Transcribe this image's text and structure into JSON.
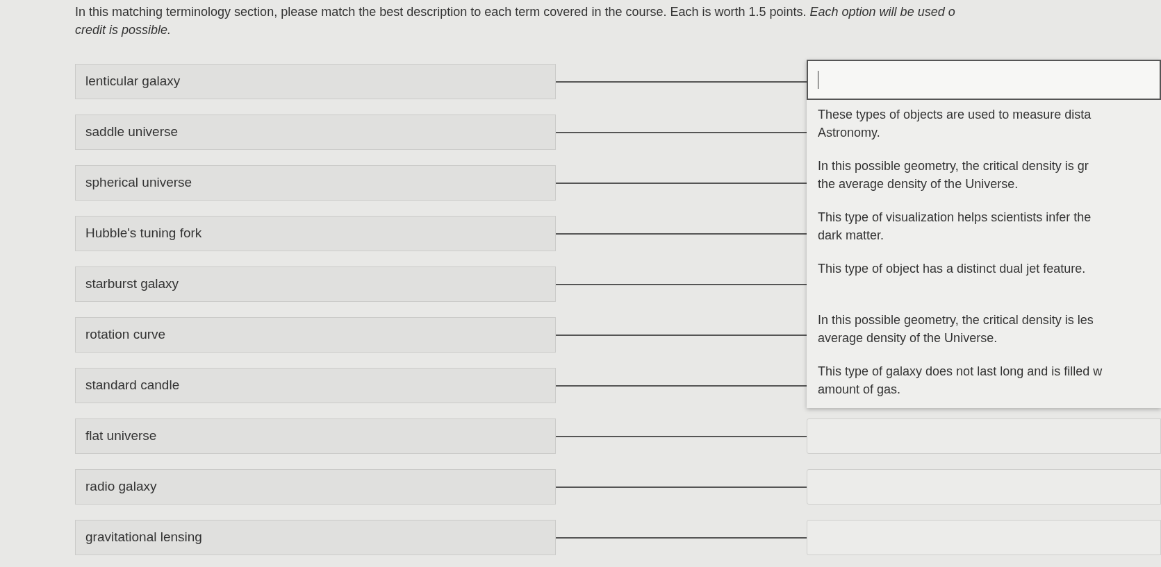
{
  "instructions": {
    "line_1": "In this matching terminology section, please match the best description to each term covered in the course. Each is worth 1.5 points. *Each option will be used o*",
    "line_2": "credit is possible."
  },
  "terms": [
    "lenticular galaxy",
    "saddle universe",
    "spherical universe",
    "Hubble's tuning fork",
    "starburst galaxy",
    "rotation curve",
    "standard candle",
    "flat universe",
    "radio galaxy",
    "gravitational lensing"
  ],
  "dropdown": {
    "expanded": true,
    "options": [
      {
        "kind": "blank",
        "selected": true
      },
      {
        "lines": [
          "These types of objects are used to measure dista",
          "Astronomy."
        ],
        "selected": false
      },
      {
        "lines": [
          "In this possible geometry, the critical density is gr",
          "the average density of the Universe."
        ],
        "selected": false
      },
      {
        "lines": [
          "This type of visualization helps scientists infer the",
          "dark matter."
        ],
        "selected": false
      },
      {
        "lines": [
          "This type of object has a distinct dual jet feature."
        ],
        "selected": false
      },
      {
        "lines": [
          "In this possible geometry, the critical density is les",
          "average density of the Universe."
        ],
        "selected": false
      },
      {
        "lines": [
          "This type of galaxy does not last long and is filled w",
          "amount of gas."
        ],
        "selected": false
      }
    ]
  }
}
